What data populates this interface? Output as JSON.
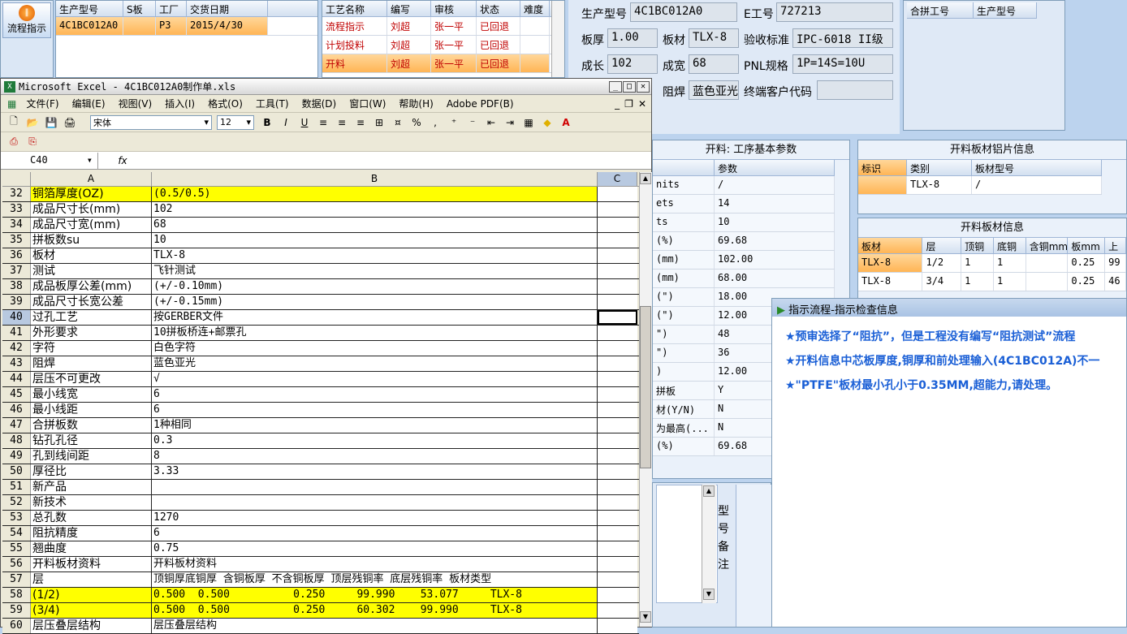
{
  "left_panel": {
    "flow_button": "流程指示"
  },
  "order_grid": {
    "headers": [
      "生产型号",
      "S板",
      "工厂",
      "交货日期"
    ],
    "rows": [
      [
        "4C1BC012A0",
        "",
        "P3",
        "2015/4/30"
      ]
    ]
  },
  "process_grid": {
    "headers": [
      "工艺名称",
      "编写",
      "审核",
      "状态",
      "难度"
    ],
    "rows": [
      [
        "流程指示",
        "刘超",
        "张一平",
        "已回退",
        ""
      ],
      [
        "计划投料",
        "刘超",
        "张一平",
        "已回退",
        ""
      ],
      [
        "开料",
        "刘超",
        "张一平",
        "已回退",
        ""
      ]
    ]
  },
  "info_form": {
    "prod_model_label": "生产型号",
    "prod_model": "4C1BC012A0",
    "eno_label": "E工号",
    "eno": "727213",
    "thickness_label": "板厚",
    "thickness": "1.00",
    "material_label": "板材",
    "material": "TLX-8",
    "standard_label": "验收标准",
    "standard": "IPC-6018 II级",
    "length_label": "成长",
    "length": "102",
    "width_label": "成宽",
    "width": "68",
    "pnl_label": "PNL规格",
    "pnl": "1P=14S=10U",
    "solder_label": "阻焊",
    "solder": "蓝色亚光",
    "customer_label": "终端客户代码",
    "customer": ""
  },
  "merge_grid": {
    "headers": [
      "合拼工号",
      "生产型号"
    ]
  },
  "cut_params": {
    "title": "开料: 工序基本参数",
    "param_header": "参数",
    "rows": [
      [
        "nits",
        "/"
      ],
      [
        "ets",
        "14"
      ],
      [
        "ts",
        "10"
      ],
      [
        "(%)",
        "69.68"
      ],
      [
        "(mm)",
        "102.00"
      ],
      [
        "(mm)",
        "68.00"
      ],
      [
        "(\")",
        "18.00"
      ],
      [
        "(\")",
        "12.00"
      ],
      [
        "\")",
        "48"
      ],
      [
        "\")",
        "36"
      ],
      [
        ")",
        "12.00"
      ],
      [
        "拼板",
        "Y"
      ],
      [
        "材(Y/N)",
        "N"
      ],
      [
        "为最高(...",
        "N"
      ],
      [
        "(%)",
        "69.68"
      ]
    ]
  },
  "al_sheet": {
    "title": "开料板材铝片信息",
    "headers": [
      "标识",
      "类别",
      "板材型号"
    ],
    "rows": [
      [
        "",
        "TLX-8",
        "/"
      ]
    ]
  },
  "board_info": {
    "title": "开料板材信息",
    "headers": [
      "板材",
      "层",
      "顶铜",
      "底铜",
      "含铜mm",
      "板mm",
      "上"
    ],
    "rows": [
      [
        "TLX-8",
        "1/2",
        "1",
        "1",
        "",
        "0.25",
        "99"
      ],
      [
        "TLX-8",
        "3/4",
        "1",
        "1",
        "",
        "0.25",
        "46"
      ]
    ]
  },
  "remark": {
    "label": "型号备注"
  },
  "dialog": {
    "title": "指示流程-指示检查信息",
    "messages": [
      "★预审选择了“阻抗”，但是工程没有编写“阻抗测试”流程",
      "★开料信息中芯板厚度,铜厚和前处理输入(4C1BC012A)不一",
      "★\"PTFE\"板材最小孔小于0.35MM,超能力,请处理。"
    ]
  },
  "excel": {
    "title": "Microsoft Excel - 4C1BC012A0制作单.xls",
    "menus": [
      "文件(F)",
      "编辑(E)",
      "视图(V)",
      "插入(I)",
      "格式(O)",
      "工具(T)",
      "数据(D)",
      "窗口(W)",
      "帮助(H)",
      "Adobe PDF(B)"
    ],
    "font_name": "宋体",
    "font_size": "12",
    "name_box": "C40",
    "fx": "fx",
    "col_headers": [
      "A",
      "B",
      "C"
    ],
    "rows": [
      {
        "n": "32",
        "a": "铜箔厚度(OZ)",
        "b": "(0.5/0.5)",
        "hl": "yel"
      },
      {
        "n": "33",
        "a": "成品尺寸长(mm)",
        "b": "102",
        "hl": "wht"
      },
      {
        "n": "34",
        "a": "成品尺寸宽(mm)",
        "b": "68",
        "hl": "wht"
      },
      {
        "n": "35",
        "a": "拼板数su",
        "b": "10",
        "hl": "wht"
      },
      {
        "n": "36",
        "a": "板材",
        "b": "TLX-8",
        "hl": "wht"
      },
      {
        "n": "37",
        "a": "测试",
        "b": "飞针测试",
        "hl": "wht"
      },
      {
        "n": "38",
        "a": "成品板厚公差(mm)",
        "b": "(+/-0.10mm)",
        "hl": "wht"
      },
      {
        "n": "39",
        "a": "成品尺寸长宽公差",
        "b": "(+/-0.15mm)",
        "hl": "wht"
      },
      {
        "n": "40",
        "a": "过孔工艺",
        "b": "按GERBER文件",
        "hl": "wht"
      },
      {
        "n": "41",
        "a": "外形要求",
        "b": "10拼板桥连+邮票孔",
        "hl": "wht"
      },
      {
        "n": "42",
        "a": "字符",
        "b": "白色字符",
        "hl": "wht"
      },
      {
        "n": "43",
        "a": "阻焊",
        "b": "蓝色亚光",
        "hl": "wht"
      },
      {
        "n": "44",
        "a": "层压不可更改",
        "b": "√",
        "hl": "wht"
      },
      {
        "n": "45",
        "a": "最小线宽",
        "b": "6",
        "hl": "wht"
      },
      {
        "n": "46",
        "a": "最小线距",
        "b": "6",
        "hl": "wht"
      },
      {
        "n": "47",
        "a": "合拼板数",
        "b": "1种相同",
        "hl": "wht"
      },
      {
        "n": "48",
        "a": "钻孔孔径",
        "b": "0.3",
        "hl": "wht"
      },
      {
        "n": "49",
        "a": "孔到线间距",
        "b": "8",
        "hl": "wht"
      },
      {
        "n": "50",
        "a": "厚径比",
        "b": "3.33",
        "hl": "wht"
      },
      {
        "n": "51",
        "a": "新产品",
        "b": "",
        "hl": "wht"
      },
      {
        "n": "52",
        "a": "新技术",
        "b": "",
        "hl": "wht"
      },
      {
        "n": "53",
        "a": "总孔数",
        "b": "1270",
        "hl": "wht"
      },
      {
        "n": "54",
        "a": "阻抗精度",
        "b": "6",
        "hl": "wht"
      },
      {
        "n": "55",
        "a": "翘曲度",
        "b": "0.75",
        "hl": "wht"
      },
      {
        "n": "56",
        "a": "开料板材资料",
        "b": "开料板材资料",
        "hl": "wht"
      },
      {
        "n": "57",
        "a": "层",
        "b": "顶铜厚底铜厚 含铜板厚 不含铜板厚 顶层残铜率 底层残铜率 板材类型",
        "hl": "wht"
      },
      {
        "n": "58",
        "a": "(1/2)",
        "b": "0.500  0.500          0.250     99.990    53.077     TLX-8",
        "hl": "yel"
      },
      {
        "n": "59",
        "a": "(3/4)",
        "b": "0.500  0.500          0.250     60.302    99.990     TLX-8",
        "hl": "yel"
      },
      {
        "n": "60",
        "a": "层压叠层结构",
        "b": "层压叠层结构",
        "hl": "wht"
      }
    ]
  }
}
